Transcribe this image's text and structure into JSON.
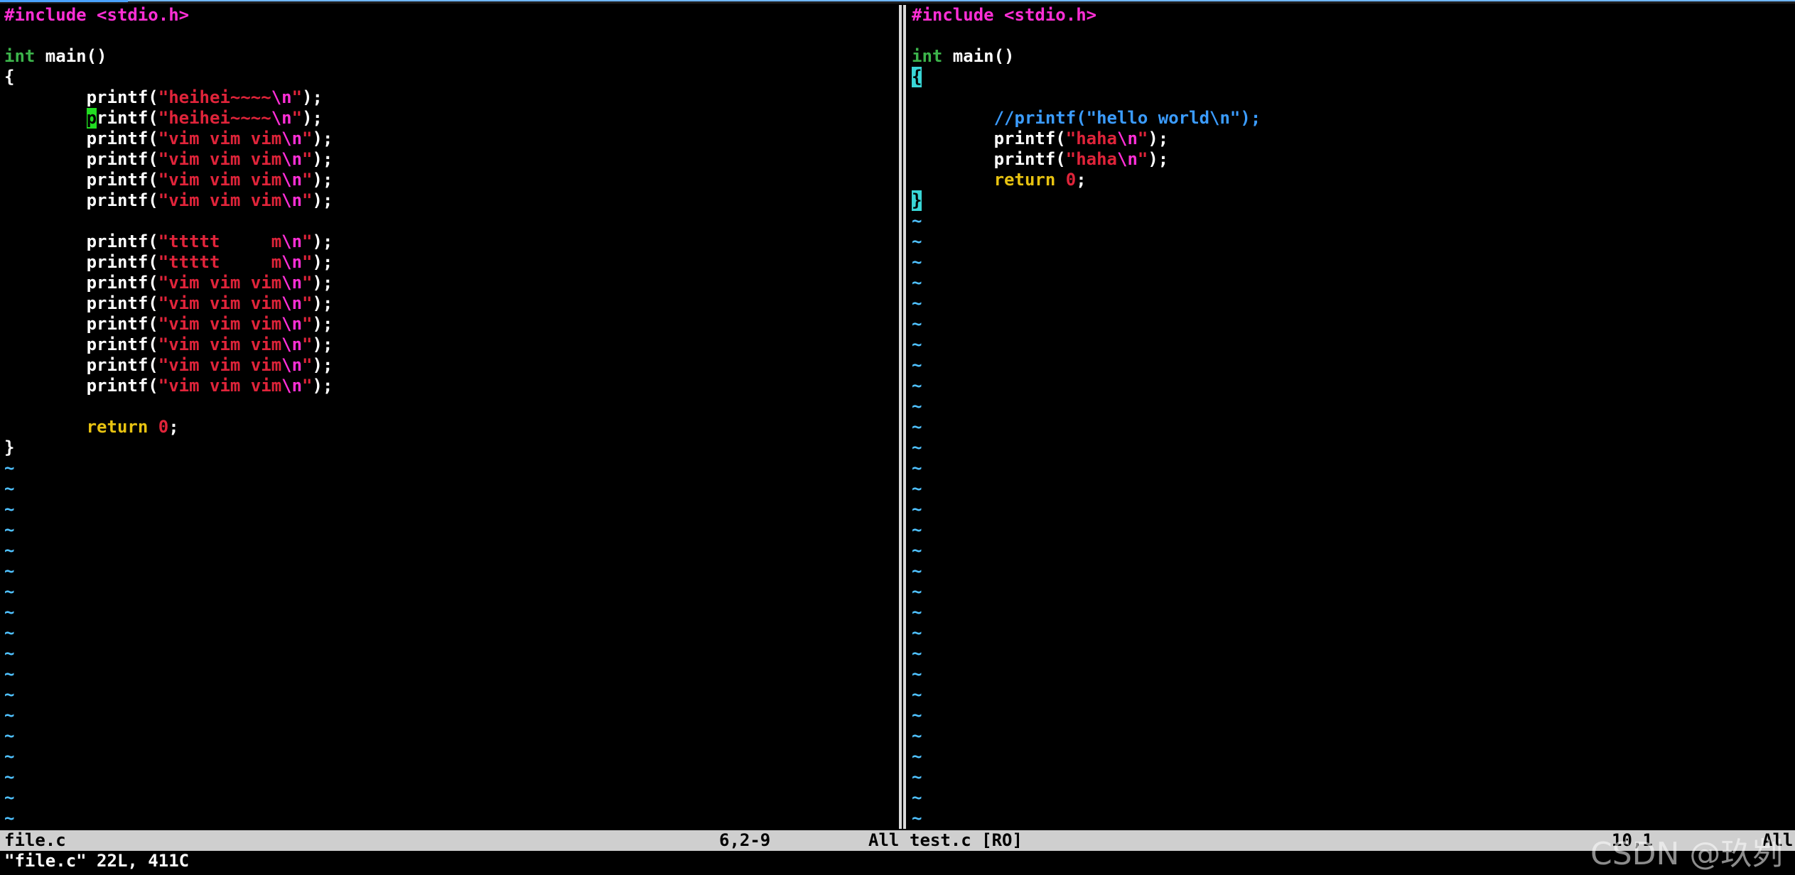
{
  "left_pane": {
    "lines": [
      [
        {
          "t": "#include <stdio.h>",
          "c": "kw-include"
        }
      ],
      [],
      [
        {
          "t": "int",
          "c": "kw-type"
        },
        {
          "t": " main()",
          "c": ""
        }
      ],
      [
        {
          "t": "{",
          "c": ""
        }
      ],
      [
        {
          "t": "        printf(",
          "c": ""
        },
        {
          "t": "\"heihei~~~~",
          "c": "str"
        },
        {
          "t": "\\n",
          "c": "esc"
        },
        {
          "t": "\"",
          "c": "str"
        },
        {
          "t": ");",
          "c": ""
        }
      ],
      [
        {
          "t": "        ",
          "c": ""
        },
        {
          "t": "p",
          "c": "cursor"
        },
        {
          "t": "rintf(",
          "c": ""
        },
        {
          "t": "\"heihei~~~~",
          "c": "str"
        },
        {
          "t": "\\n",
          "c": "esc"
        },
        {
          "t": "\"",
          "c": "str"
        },
        {
          "t": ");",
          "c": ""
        }
      ],
      [
        {
          "t": "        printf(",
          "c": ""
        },
        {
          "t": "\"vim vim vim",
          "c": "str"
        },
        {
          "t": "\\n",
          "c": "esc"
        },
        {
          "t": "\"",
          "c": "str"
        },
        {
          "t": ");",
          "c": ""
        }
      ],
      [
        {
          "t": "        printf(",
          "c": ""
        },
        {
          "t": "\"vim vim vim",
          "c": "str"
        },
        {
          "t": "\\n",
          "c": "esc"
        },
        {
          "t": "\"",
          "c": "str"
        },
        {
          "t": ");",
          "c": ""
        }
      ],
      [
        {
          "t": "        printf(",
          "c": ""
        },
        {
          "t": "\"vim vim vim",
          "c": "str"
        },
        {
          "t": "\\n",
          "c": "esc"
        },
        {
          "t": "\"",
          "c": "str"
        },
        {
          "t": ");",
          "c": ""
        }
      ],
      [
        {
          "t": "        printf(",
          "c": ""
        },
        {
          "t": "\"vim vim vim",
          "c": "str"
        },
        {
          "t": "\\n",
          "c": "esc"
        },
        {
          "t": "\"",
          "c": "str"
        },
        {
          "t": ");",
          "c": ""
        }
      ],
      [],
      [
        {
          "t": "        printf(",
          "c": ""
        },
        {
          "t": "\"ttttt     m",
          "c": "str"
        },
        {
          "t": "\\n",
          "c": "esc"
        },
        {
          "t": "\"",
          "c": "str"
        },
        {
          "t": ");",
          "c": ""
        }
      ],
      [
        {
          "t": "        printf(",
          "c": ""
        },
        {
          "t": "\"ttttt     m",
          "c": "str"
        },
        {
          "t": "\\n",
          "c": "esc"
        },
        {
          "t": "\"",
          "c": "str"
        },
        {
          "t": ");",
          "c": ""
        }
      ],
      [
        {
          "t": "        printf(",
          "c": ""
        },
        {
          "t": "\"vim vim vim",
          "c": "str"
        },
        {
          "t": "\\n",
          "c": "esc"
        },
        {
          "t": "\"",
          "c": "str"
        },
        {
          "t": ");",
          "c": ""
        }
      ],
      [
        {
          "t": "        printf(",
          "c": ""
        },
        {
          "t": "\"vim vim vim",
          "c": "str"
        },
        {
          "t": "\\n",
          "c": "esc"
        },
        {
          "t": "\"",
          "c": "str"
        },
        {
          "t": ");",
          "c": ""
        }
      ],
      [
        {
          "t": "        printf(",
          "c": ""
        },
        {
          "t": "\"vim vim vim",
          "c": "str"
        },
        {
          "t": "\\n",
          "c": "esc"
        },
        {
          "t": "\"",
          "c": "str"
        },
        {
          "t": ");",
          "c": ""
        }
      ],
      [
        {
          "t": "        printf(",
          "c": ""
        },
        {
          "t": "\"vim vim vim",
          "c": "str"
        },
        {
          "t": "\\n",
          "c": "esc"
        },
        {
          "t": "\"",
          "c": "str"
        },
        {
          "t": ");",
          "c": ""
        }
      ],
      [
        {
          "t": "        printf(",
          "c": ""
        },
        {
          "t": "\"vim vim vim",
          "c": "str"
        },
        {
          "t": "\\n",
          "c": "esc"
        },
        {
          "t": "\"",
          "c": "str"
        },
        {
          "t": ");",
          "c": ""
        }
      ],
      [
        {
          "t": "        printf(",
          "c": ""
        },
        {
          "t": "\"vim vim vim",
          "c": "str"
        },
        {
          "t": "\\n",
          "c": "esc"
        },
        {
          "t": "\"",
          "c": "str"
        },
        {
          "t": ");",
          "c": ""
        }
      ],
      [],
      [
        {
          "t": "        ",
          "c": ""
        },
        {
          "t": "return",
          "c": "kw-ctrl"
        },
        {
          "t": " ",
          "c": ""
        },
        {
          "t": "0",
          "c": "num"
        },
        {
          "t": ";",
          "c": ""
        }
      ],
      [
        {
          "t": "}",
          "c": ""
        }
      ]
    ],
    "empty_marker": "~",
    "empty_count": 18
  },
  "right_pane": {
    "lines": [
      [
        {
          "t": "#include <stdio.h>",
          "c": "kw-include"
        }
      ],
      [],
      [
        {
          "t": "int",
          "c": "kw-type"
        },
        {
          "t": " main()",
          "c": ""
        }
      ],
      [
        {
          "t": "{",
          "c": "brace-match"
        }
      ],
      [],
      [
        {
          "t": "        ",
          "c": ""
        },
        {
          "t": "//printf(\"hello world\\n\");",
          "c": "comment"
        }
      ],
      [
        {
          "t": "        printf(",
          "c": ""
        },
        {
          "t": "\"haha",
          "c": "str"
        },
        {
          "t": "\\n",
          "c": "esc"
        },
        {
          "t": "\"",
          "c": "str"
        },
        {
          "t": ");",
          "c": ""
        }
      ],
      [
        {
          "t": "        printf(",
          "c": ""
        },
        {
          "t": "\"haha",
          "c": "str"
        },
        {
          "t": "\\n",
          "c": "esc"
        },
        {
          "t": "\"",
          "c": "str"
        },
        {
          "t": ");",
          "c": ""
        }
      ],
      [
        {
          "t": "        ",
          "c": ""
        },
        {
          "t": "return",
          "c": "kw-ctrl"
        },
        {
          "t": " ",
          "c": ""
        },
        {
          "t": "0",
          "c": "num"
        },
        {
          "t": ";",
          "c": ""
        }
      ],
      [
        {
          "t": "}",
          "c": "brace-match"
        }
      ],
      [],
      [],
      [],
      [],
      [],
      [],
      [],
      [],
      [],
      [],
      [],
      [],
      [],
      [],
      [],
      [],
      [],
      [],
      [],
      [],
      [],
      [],
      [],
      [],
      [],
      [],
      [],
      [],
      [],
      []
    ],
    "empty_marker": "~",
    "tilde_from_line": 11,
    "tilde_count": 29
  },
  "statusline": {
    "left_name": "file.c",
    "left_pos": "6,2-9",
    "left_pct": "All",
    "right_name": "test.c [RO]",
    "right_pos": "10,1",
    "right_pct": "All"
  },
  "cmdline": "\"file.c\" 22L, 411C",
  "watermark": "CSDN @玖刿"
}
